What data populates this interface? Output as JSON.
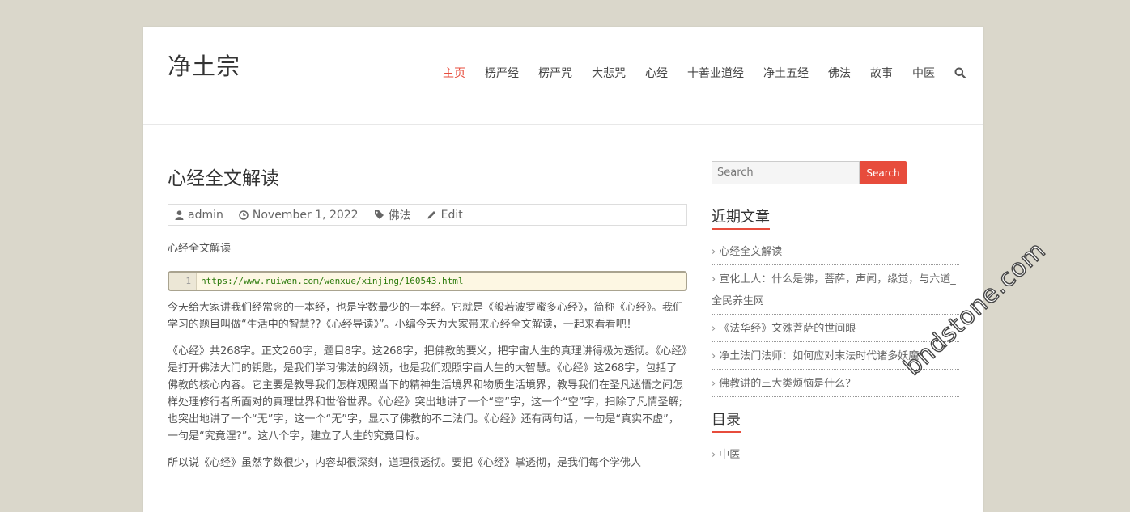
{
  "site": {
    "title": "净土宗"
  },
  "nav": {
    "items": [
      "主页",
      "楞严经",
      "楞严咒",
      "大悲咒",
      "心经",
      "十善业道经",
      "净土五经",
      "佛法",
      "故事",
      "中医"
    ],
    "search_icon": "search-icon"
  },
  "post": {
    "title": "心经全文解读",
    "meta": {
      "author": "admin",
      "date": "November 1, 2022",
      "category": "佛法",
      "edit": "Edit"
    },
    "intro": "心经全文解读",
    "code": {
      "line": "1",
      "text": "https://www.ruiwen.com/wenxue/xinjing/160543.html"
    },
    "paragraphs": [
      "今天给大家讲我们经常念的一本经，也是字数最少的一本经。它就是《般若波罗蜜多心经》，简称《心经》。我们学习的题目叫做“生活中的智慧??《心经导读》”。小编今天为大家带来心经全文解读，一起来看看吧！",
      "《心经》共268字。正文260字，题目8字。这268字，把佛教的要义，把宇宙人生的真理讲得极为透彻。《心经》是打开佛法大门的钥匙，是我们学习佛法的纲领，也是我们观照宇宙人生的大智慧。《心经》这268字，包括了佛教的核心内容。它主要是教导我们怎样观照当下的精神生活境界和物质生活境界，教导我们在圣凡迷悟之间怎样处理修行者所面对的真理世界和世俗世界。《心经》突出地讲了一个“空”字，这一个“空”字，扫除了凡情圣解;也突出地讲了一个“无”字，这一个“无”字，显示了佛教的不二法门。《心经》还有两句话，一句是“真实不虚”，一句是“究竟涅?”。这八个字，建立了人生的究竟目标。",
      "所以说《心经》虽然字数很少，内容却很深刻，道理很透彻。要把《心经》掌透彻，是我们每个学佛人"
    ]
  },
  "sidebar": {
    "search_placeholder": "Search",
    "search_button": "Search",
    "recent_title": "近期文章",
    "recent": [
      "心经全文解读",
      "宣化上人：什么是佛，菩萨，声闻，缘觉，与六道_全民养生网",
      "《法华经》文殊菩萨的世间眼",
      "净土法门法师：如何应对末法时代诸多妖魔",
      "佛教讲的三大类烦恼是什么？"
    ],
    "toc_title": "目录",
    "toc": [
      "中医"
    ]
  },
  "watermark": "bndstone.com",
  "colors": {
    "accent": "#e74c3c",
    "background": "#dad7cb"
  }
}
